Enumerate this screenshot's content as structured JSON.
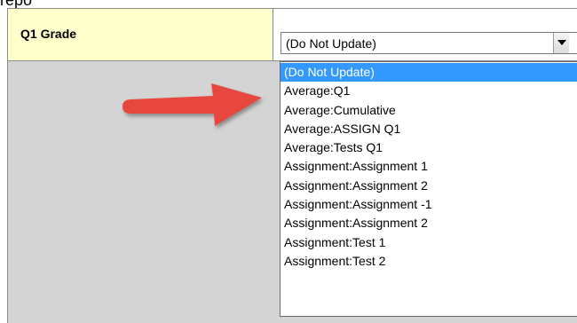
{
  "caption_text": "repo",
  "field": {
    "label": "Q1 Grade",
    "selected_value": "(Do Not Update)"
  },
  "dropdown": {
    "options": [
      {
        "label": "(Do Not Update)",
        "selected": true
      },
      {
        "label": "Average:Q1",
        "selected": false
      },
      {
        "label": "Average:Cumulative",
        "selected": false
      },
      {
        "label": "Average:ASSIGN Q1",
        "selected": false
      },
      {
        "label": "Average:Tests Q1",
        "selected": false
      },
      {
        "label": "Assignment:Assignment 1",
        "selected": false
      },
      {
        "label": "Assignment:Assignment 2",
        "selected": false
      },
      {
        "label": "Assignment:Assignment -1",
        "selected": false
      },
      {
        "label": "Assignment:Assignment 2",
        "selected": false
      },
      {
        "label": "Assignment:Test 1",
        "selected": false
      },
      {
        "label": "Assignment:Test 2",
        "selected": false
      }
    ]
  },
  "colors": {
    "label_cell_background": "#ffffcc",
    "panel_background": "#d4d4d4",
    "selected_option_background": "#3399ff",
    "callout_arrow": "#e8463c"
  },
  "icons": {
    "select_arrow": "triangle-down-icon",
    "callout": "red-arrow-right-icon"
  }
}
